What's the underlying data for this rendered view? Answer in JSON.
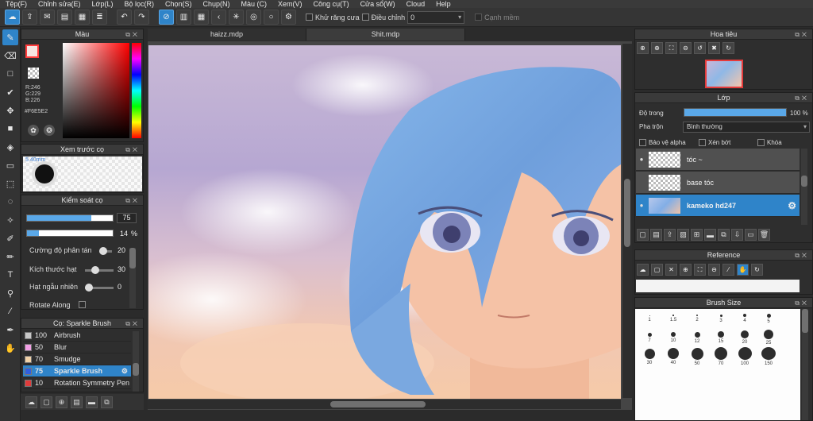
{
  "menu": [
    "Tệp(F)",
    "Chỉnh sửa(E)",
    "Lớp(L)",
    "Bộ lọc(R)",
    "Chọn(S)",
    "Chụp(N)",
    "Màu (C)",
    "Xem(V)",
    "Công cụ(T)",
    "Cửa sổ(W)",
    "Cloud",
    "Help"
  ],
  "toolbar": {
    "antialias_label": "Khử răng cưa",
    "correction_label": "Điều chỉnh",
    "correction_value": "0",
    "soft_edge_label": "Cạnh mềm"
  },
  "color_panel": {
    "title": "Màu",
    "r": "R:246",
    "g": "G:229",
    "b": "B:226",
    "hex": "#F6E5E2",
    "accent": "#F6E5E2"
  },
  "brush_preview": {
    "title": "Xem trước cọ",
    "size_label": "5.40mm"
  },
  "brush_control": {
    "title": "Kiểm soát cọ",
    "size_value": "75",
    "size_fraction": 0.75,
    "opacity_value": "14",
    "opacity_unit": "%",
    "opacity_fraction": 0.14,
    "rows": [
      {
        "label": "Cường độ phân tán",
        "value": "20"
      },
      {
        "label": "Kích thước hạt",
        "value": "30"
      },
      {
        "label": "Hạt ngẫu nhiên",
        "value": "0"
      },
      {
        "label": "Rotate Along",
        "value": ""
      }
    ]
  },
  "brush_list": {
    "title": "Cọ: Sparkle Brush",
    "items": [
      {
        "size": "100",
        "name": "Airbrush",
        "color": "#c8c8c8"
      },
      {
        "size": "50",
        "name": "Blur",
        "color": "#f3a0e6"
      },
      {
        "size": "70",
        "name": "Smudge",
        "color": "#f1d2a7"
      },
      {
        "size": "75",
        "name": "Sparkle Brush",
        "color": "#2f5fe0"
      },
      {
        "size": "10",
        "name": "Rotation Symmetry Pen",
        "color": "#e03b3b"
      }
    ]
  },
  "tabs": [
    "haizz.mdp",
    "Shit.mdp"
  ],
  "navigator": {
    "title": "Hoa tiêu"
  },
  "layer_panel": {
    "title": "Lớp",
    "opacity_label": "Độ trong",
    "opacity_value": "100 %",
    "blend_label": "Pha trộn",
    "blend_value": "Bình thường",
    "protect_alpha": "Bảo vệ alpha",
    "clipping": "Xén bớt",
    "lock": "Khóa",
    "layers": [
      {
        "name": "tóc ~"
      },
      {
        "name": "base tóc"
      },
      {
        "name": "kameko hd247"
      }
    ]
  },
  "reference": {
    "title": "Reference"
  },
  "brush_size": {
    "title": "Brush Size",
    "sizes": [
      "1",
      "1.5",
      "2",
      "3",
      "4",
      "5",
      "7",
      "10",
      "12",
      "15",
      "20",
      "25",
      "30",
      "40",
      "50",
      "70",
      "100",
      "150"
    ]
  }
}
